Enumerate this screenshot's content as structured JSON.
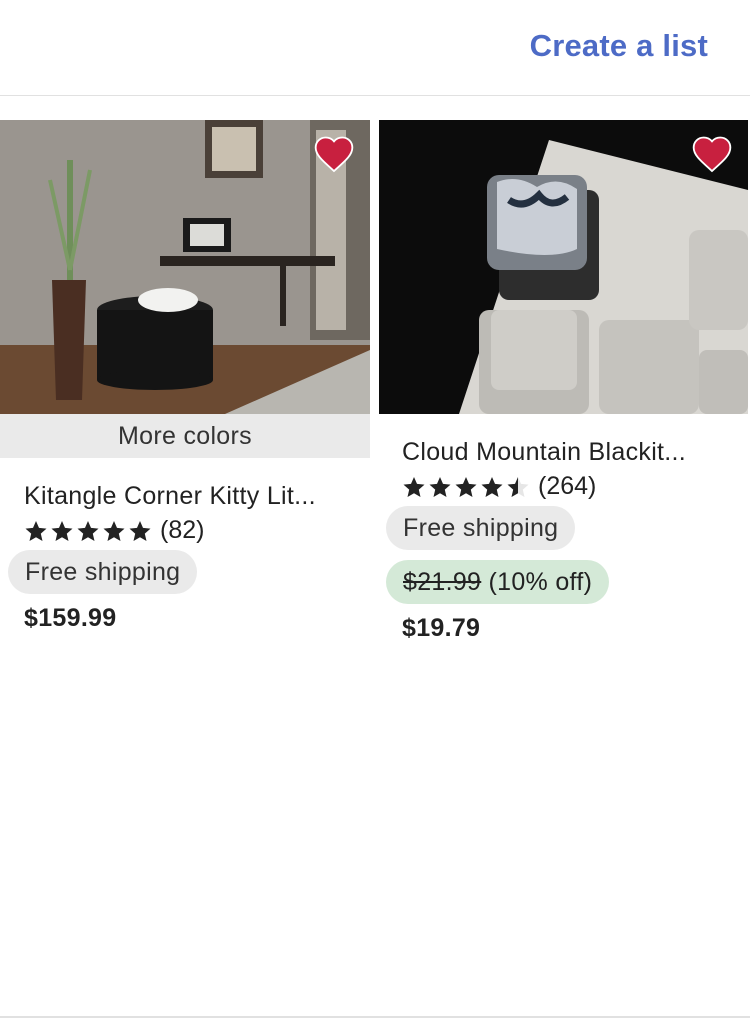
{
  "header": {
    "create_list_label": "Create a list"
  },
  "listings": [
    {
      "image_desc": "black-round-litter-box-with-white-cat-photo",
      "favorite_color": "#c8203f",
      "more_colors_label": "More colors",
      "title": "Kitangle Corner Kitty Lit...",
      "rating_stars": 5,
      "review_count": "(82)",
      "shipping_label": "Free shipping",
      "price": "$159.99"
    },
    {
      "image_desc": "keycap-on-white-keyboard-photo",
      "favorite_color": "#c8203f",
      "title": "Cloud Mountain Blackit...",
      "rating_stars": 4.5,
      "review_count": "(264)",
      "shipping_label": "Free shipping",
      "original_price": "$21.99",
      "discount_label": "(10% off)",
      "price": "$19.79"
    }
  ],
  "colors": {
    "accent_link": "#4d6bc6",
    "pill_gray": "#eaeaea",
    "sale_green": "#d4e9d7"
  }
}
